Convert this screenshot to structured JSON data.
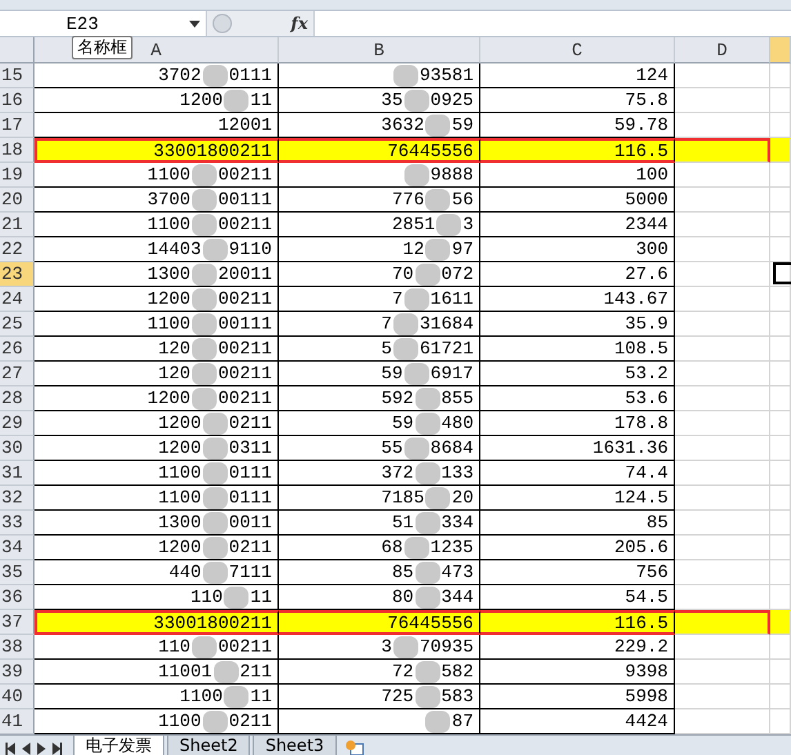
{
  "name_box": {
    "value": "E23",
    "tooltip": "名称框"
  },
  "formula_bar": {
    "fx": "fx"
  },
  "columns": [
    {
      "label": "A",
      "selected": false
    },
    {
      "label": "B",
      "selected": false
    },
    {
      "label": "C",
      "selected": false
    },
    {
      "label": "D",
      "selected": false
    },
    {
      "selected": true
    }
  ],
  "rows": [
    {
      "number": "15",
      "selected": false,
      "highlighted": false,
      "a": {
        "before": "3702",
        "after": "0111"
      },
      "b": {
        "after": "93581"
      },
      "c": "124"
    },
    {
      "number": "16",
      "selected": false,
      "highlighted": false,
      "a": {
        "before": "1200",
        "after": "11"
      },
      "b": {
        "before": "35",
        "after": "0925"
      },
      "c": "75.8"
    },
    {
      "number": "17",
      "selected": false,
      "highlighted": false,
      "a": {
        "before": "12001"
      },
      "b": {
        "before": "3632",
        "after": "59"
      },
      "c": "59.78"
    },
    {
      "number": "18",
      "selected": false,
      "highlighted": true,
      "a": {
        "before": "33001800211"
      },
      "b": {
        "before": "76445556"
      },
      "c": "116.5"
    },
    {
      "number": "19",
      "selected": false,
      "highlighted": false,
      "a": {
        "before": "1100",
        "after": "00211"
      },
      "b": {
        "after": "9888"
      },
      "c": "100"
    },
    {
      "number": "20",
      "selected": false,
      "highlighted": false,
      "a": {
        "before": "3700",
        "after": "00111"
      },
      "b": {
        "before": "776",
        "after": "56"
      },
      "c": "5000"
    },
    {
      "number": "21",
      "selected": false,
      "highlighted": false,
      "a": {
        "before": "1100",
        "after": "00211"
      },
      "b": {
        "before": "2851",
        "after": "3"
      },
      "c": "2344"
    },
    {
      "number": "22",
      "selected": false,
      "highlighted": false,
      "a": {
        "before": "14403",
        "after": "9110"
      },
      "b": {
        "before": "12",
        "after": "97"
      },
      "c": "300"
    },
    {
      "number": "23",
      "selected": true,
      "highlighted": false,
      "a": {
        "before": "1300",
        "after": "20011"
      },
      "b": {
        "before": "70",
        "after": "072"
      },
      "c": "27.6"
    },
    {
      "number": "24",
      "selected": false,
      "highlighted": false,
      "a": {
        "before": "1200",
        "after": "00211"
      },
      "b": {
        "before": "7",
        "after": "1611"
      },
      "c": "143.67"
    },
    {
      "number": "25",
      "selected": false,
      "highlighted": false,
      "a": {
        "before": "1100",
        "after": "00111"
      },
      "b": {
        "before": "7",
        "after": "31684"
      },
      "c": "35.9"
    },
    {
      "number": "26",
      "selected": false,
      "highlighted": false,
      "a": {
        "before": "120",
        "after": "00211"
      },
      "b": {
        "before": "5",
        "after": "61721"
      },
      "c": "108.5"
    },
    {
      "number": "27",
      "selected": false,
      "highlighted": false,
      "a": {
        "before": "120",
        "after": "00211"
      },
      "b": {
        "before": "59",
        "after": "6917"
      },
      "c": "53.2"
    },
    {
      "number": "28",
      "selected": false,
      "highlighted": false,
      "a": {
        "before": "1200",
        "after": "00211"
      },
      "b": {
        "before": "592",
        "after": "855"
      },
      "c": "53.6"
    },
    {
      "number": "29",
      "selected": false,
      "highlighted": false,
      "a": {
        "before": "1200",
        "after": "0211"
      },
      "b": {
        "before": "59",
        "after": "480"
      },
      "c": "178.8"
    },
    {
      "number": "30",
      "selected": false,
      "highlighted": false,
      "a": {
        "before": "1200",
        "after": "0311"
      },
      "b": {
        "before": "55",
        "after": "8684"
      },
      "c": "1631.36"
    },
    {
      "number": "31",
      "selected": false,
      "highlighted": false,
      "a": {
        "before": "1100",
        "after": "0111"
      },
      "b": {
        "before": "372",
        "after": "133"
      },
      "c": "74.4"
    },
    {
      "number": "32",
      "selected": false,
      "highlighted": false,
      "a": {
        "before": "1100",
        "after": "0111"
      },
      "b": {
        "before": "7185",
        "after": "20"
      },
      "c": "124.5"
    },
    {
      "number": "33",
      "selected": false,
      "highlighted": false,
      "a": {
        "before": "1300",
        "after": "0011"
      },
      "b": {
        "before": "51",
        "after": "334"
      },
      "c": "85"
    },
    {
      "number": "34",
      "selected": false,
      "highlighted": false,
      "a": {
        "before": "1200",
        "after": "0211"
      },
      "b": {
        "before": "68",
        "after": "1235"
      },
      "c": "205.6"
    },
    {
      "number": "35",
      "selected": false,
      "highlighted": false,
      "a": {
        "before": "440",
        "after": "7111"
      },
      "b": {
        "before": "85",
        "after": "473"
      },
      "c": "756"
    },
    {
      "number": "36",
      "selected": false,
      "highlighted": false,
      "a": {
        "before": "110",
        "after": "11"
      },
      "b": {
        "before": "80",
        "after": "344"
      },
      "c": "54.5"
    },
    {
      "number": "37",
      "selected": false,
      "highlighted": true,
      "a": {
        "before": "33001800211"
      },
      "b": {
        "before": "76445556"
      },
      "c": "116.5"
    },
    {
      "number": "38",
      "selected": false,
      "highlighted": false,
      "a": {
        "before": "110",
        "after": "00211"
      },
      "b": {
        "before": "3",
        "after": "70935"
      },
      "c": "229.2"
    },
    {
      "number": "39",
      "selected": false,
      "highlighted": false,
      "a": {
        "before": "11001",
        "after": "211"
      },
      "b": {
        "before": "72",
        "after": "582"
      },
      "c": "9398"
    },
    {
      "number": "40",
      "selected": false,
      "highlighted": false,
      "a": {
        "before": "1100",
        "after": "11"
      },
      "b": {
        "before": "725",
        "after": "583"
      },
      "c": "5998"
    },
    {
      "number": "41",
      "selected": false,
      "highlighted": false,
      "a": {
        "before": "1100",
        "after": "0211"
      },
      "b": {
        "after": "87"
      },
      "c": "4424"
    }
  ],
  "sheet_tabs": [
    {
      "label": "电子发票",
      "selected": true
    },
    {
      "label": "Sheet2",
      "selected": false
    },
    {
      "label": "Sheet3",
      "selected": false
    }
  ]
}
